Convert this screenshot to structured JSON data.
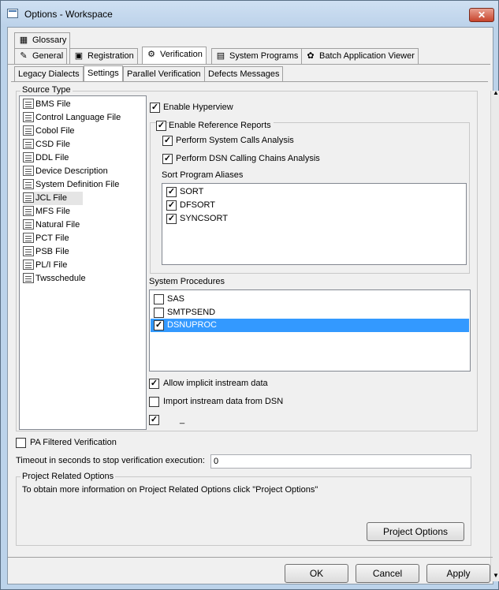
{
  "window": {
    "title": "Options - Workspace",
    "close_label": "✕"
  },
  "tabs_row1": [
    {
      "label": "Glossary",
      "icon": "glossary-icon"
    }
  ],
  "tabs_row2": [
    {
      "label": "General",
      "icon": "general-icon"
    },
    {
      "label": "Registration",
      "icon": "registration-icon"
    },
    {
      "label": "Verification",
      "icon": "verification-icon"
    },
    {
      "label": "System Programs",
      "icon": "system-programs-icon"
    },
    {
      "label": "Batch Application Viewer",
      "icon": "batch-viewer-icon"
    }
  ],
  "subtabs": [
    "Legacy Dialects",
    "Settings",
    "Parallel Verification",
    "Defects Messages"
  ],
  "source_type": {
    "label": "Source Type",
    "items": [
      "BMS File",
      "Control Language File",
      "Cobol File",
      "CSD File",
      "DDL File",
      "Device Description",
      "System Definition File",
      "JCL File",
      "MFS File",
      "Natural File",
      "PCT File",
      "PSB File",
      "PL/I File",
      "Twsschedule"
    ],
    "selected": "JCL File"
  },
  "options": {
    "enable_hyperview": "Enable Hyperview",
    "enable_reference_reports": "Enable Reference Reports",
    "perform_system_calls": "Perform System Calls Analysis",
    "perform_dsn_calling": "Perform DSN Calling Chains Analysis",
    "sort_aliases_label": "Sort Program Aliases",
    "sort_aliases": [
      "SORT",
      "DFSORT",
      "SYNCSORT"
    ],
    "system_procedures_label": "System Procedures",
    "system_procedures": [
      {
        "label": "SAS",
        "checked": false
      },
      {
        "label": "SMTPSEND",
        "checked": false
      },
      {
        "label": "DSNUPROC",
        "checked": true
      }
    ],
    "allow_implicit": "Allow implicit instream data",
    "import_instream": "Import instream data from DSN",
    "blank_checkbox_label": "_"
  },
  "pa_filtered": "PA Filtered Verification",
  "timeout": {
    "label": "Timeout in seconds to stop verification execution:",
    "value": "0"
  },
  "project": {
    "group_label": "Project Related Options",
    "info": "To obtain more information on Project Related Options click \"Project Options\"",
    "button": "Project Options"
  },
  "footer": {
    "ok": "OK",
    "cancel": "Cancel",
    "apply": "Apply"
  },
  "check_mark": "✓"
}
